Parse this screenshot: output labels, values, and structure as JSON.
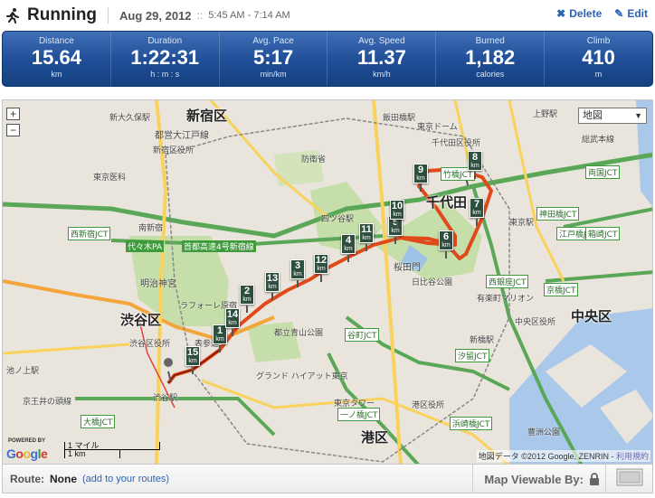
{
  "header": {
    "title": "Running",
    "date": "Aug 29, 2012",
    "separator": "::",
    "time_range": "5:45 AM - 7:14 AM",
    "delete_label": "Delete",
    "edit_label": "Edit"
  },
  "stats": [
    {
      "label": "Distance",
      "value": "15.64",
      "unit": "km"
    },
    {
      "label": "Duration",
      "value": "1:22:31",
      "unit": "h : m : s"
    },
    {
      "label": "Avg. Pace",
      "value": "5:17",
      "unit": "min/km"
    },
    {
      "label": "Avg. Speed",
      "value": "11.37",
      "unit": "km/h"
    },
    {
      "label": "Burned",
      "value": "1,182",
      "unit": "calories"
    },
    {
      "label": "Climb",
      "value": "410",
      "unit": "m"
    }
  ],
  "map": {
    "zoom_in": "+",
    "zoom_out": "−",
    "map_type": "地図",
    "powered_by": "POWERED BY",
    "google_logo": "Google",
    "scale_miles": "1 マイル",
    "scale_km": "1 km",
    "copyright": "地図データ ©2012 Google, ZENRIN - ",
    "terms_link": "利用規約",
    "labels": {
      "shinjuku_ku": "新宿区",
      "shibuya_ku": "渋谷区",
      "chiyoda": "千代田",
      "chuo_ku": "中央区",
      "minato_ku": "港区",
      "shin_okubo": "新大久保駅",
      "oedo_line": "都営大江戸線",
      "shinjuku_office": "新宿区役所",
      "tokyo_medical": "東京医科",
      "minami_shinjuku": "南新宿",
      "nishi_shinjuku_jct": "西新宿JCT",
      "yoyogi_pa": "代々木PA",
      "shuto_4": "首都高速4号新宿線",
      "meiji_jingu": "明治神宮",
      "laforet": "ラフォーレ原宿",
      "shibuya_office": "渋谷区役所",
      "shibuya_st": "渋谷駅",
      "keio_inokashira": "京王井の頭線",
      "ikenoue": "池ノ上駅",
      "ohashi_jct": "大橋JCT",
      "omotesando": "表参道",
      "aoyama_cemetery": "都立青山公園",
      "grand_hyatt": "グランド ハイアット東京",
      "yotsuya": "四ツ谷駅",
      "defense_ministry": "防衛省",
      "iidabashi": "飯田橋駅",
      "tokyo_dome": "東京ドーム",
      "chiyoda_office": "千代田区役所",
      "takebashi_jct": "竹橋JCT",
      "edobashi_jct": "江戸橋JCT",
      "kanda_bridge_jct": "神田橋JCT",
      "nishi_ginza_jct": "西銀座JCT",
      "kyobashi_jct": "京橋JCT",
      "hakozaki_jct": "箱崎JCT",
      "ryogoku_jct": "両国JCT",
      "sakuradamon": "桜田門",
      "hibiya_park": "日比谷公園",
      "yurakucho": "有楽町マリオン",
      "tanimachi_jct": "谷町JCT",
      "shiodome_jct": "汐留JCT",
      "ichinohashi_jct": "一ノ橋JCT",
      "hamazakibashi_jct": "浜崎橋JCT",
      "tokyo_tower": "東京タワー",
      "minato_office": "港区役所",
      "toyosu_park": "豊洲公園",
      "chuo_office": "中央区役所",
      "shinbashi": "新橋駅",
      "tokyo_st": "東京駅",
      "sumida": "総武本線",
      "ueno": "上野駅"
    },
    "markers": [
      "1",
      "2",
      "3",
      "4",
      "5",
      "6",
      "7",
      "8",
      "9",
      "10",
      "11",
      "12",
      "13",
      "14",
      "15"
    ],
    "marker_unit": "km"
  },
  "footer": {
    "route_label": "Route:",
    "route_value": "None",
    "route_add": "(add to your routes)",
    "viewable_label": "Map Viewable By:"
  }
}
